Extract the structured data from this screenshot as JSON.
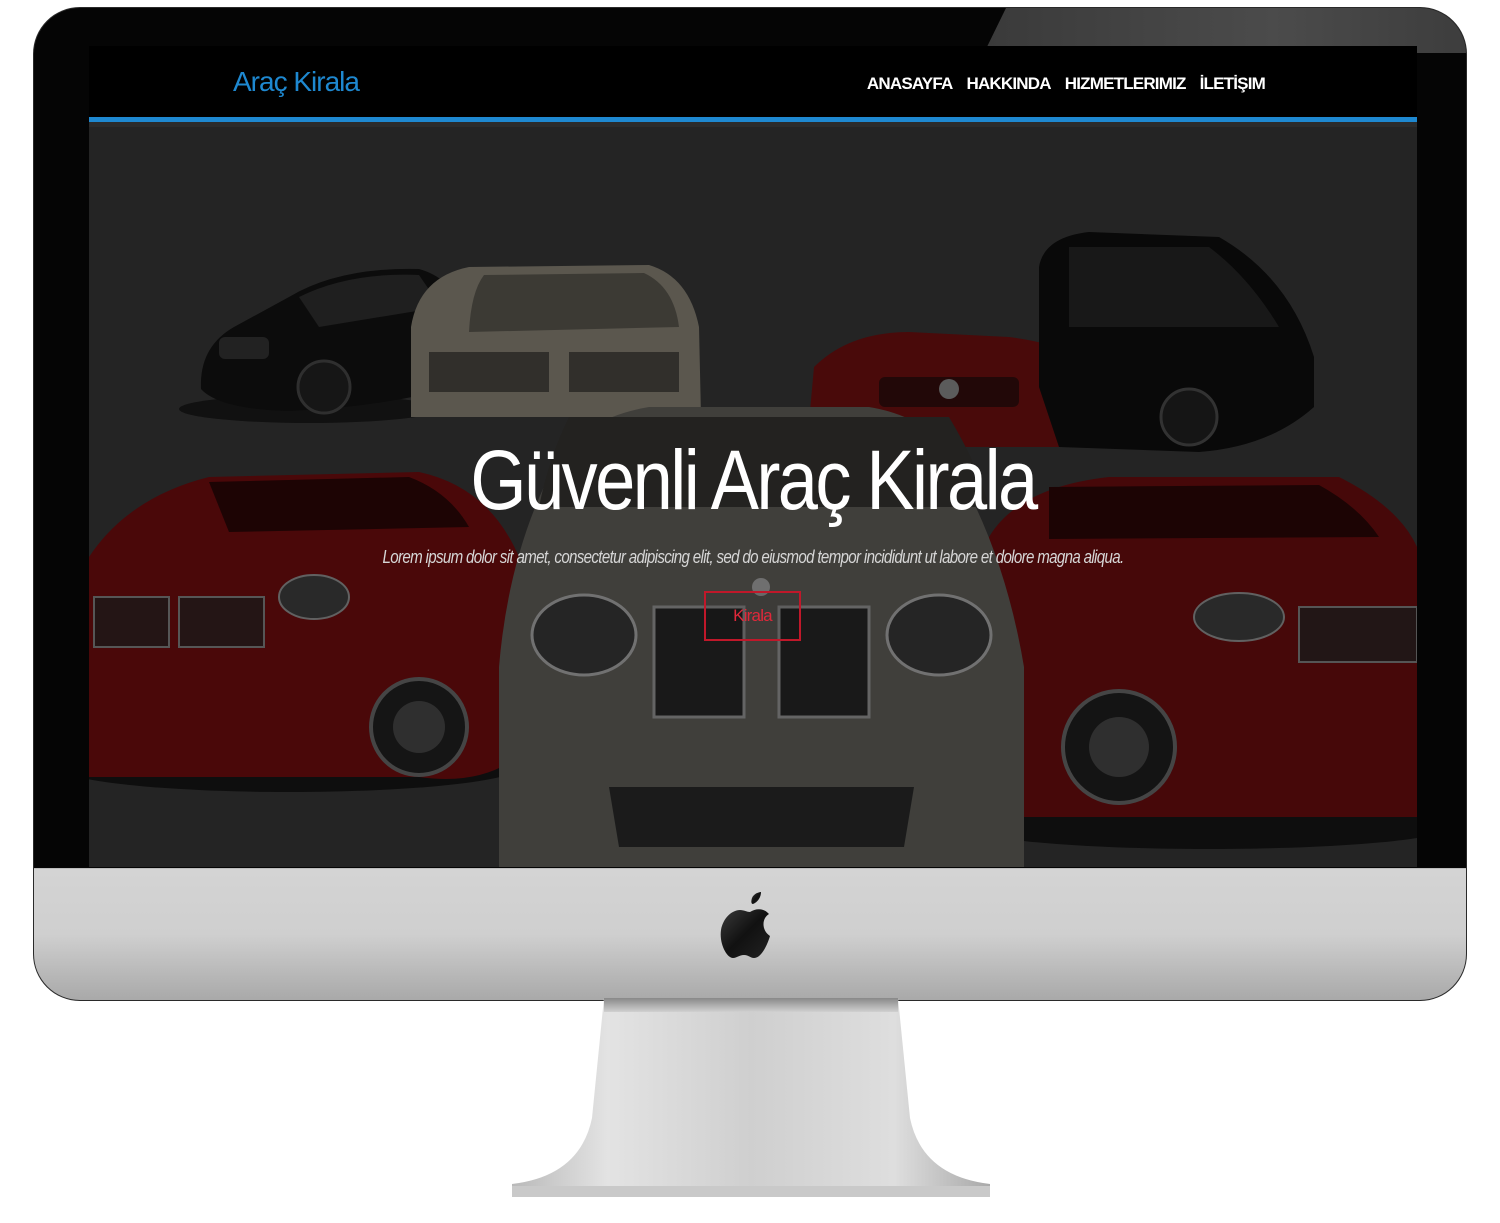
{
  "site": {
    "brand": "Araç Kirala",
    "nav": [
      "ANASAYFA",
      "HAKKINDA",
      "HIZMETLERIMIZ",
      "İLETİŞIM"
    ],
    "hero": {
      "title": "Güvenli Araç Kirala",
      "subtitle": "Lorem ipsum dolor sit amet, consectetur adipiscing elit, sed do eiusmod tempor incididunt ut labore et dolore magna aliqua.",
      "button_label": "Kirala"
    }
  },
  "device": {
    "logo": "apple-logo-icon"
  },
  "colors": {
    "accent": "#1e88d0",
    "button_border": "#c0182a",
    "header_bg": "#000000",
    "hero_overlay": "#2b2b2b"
  }
}
